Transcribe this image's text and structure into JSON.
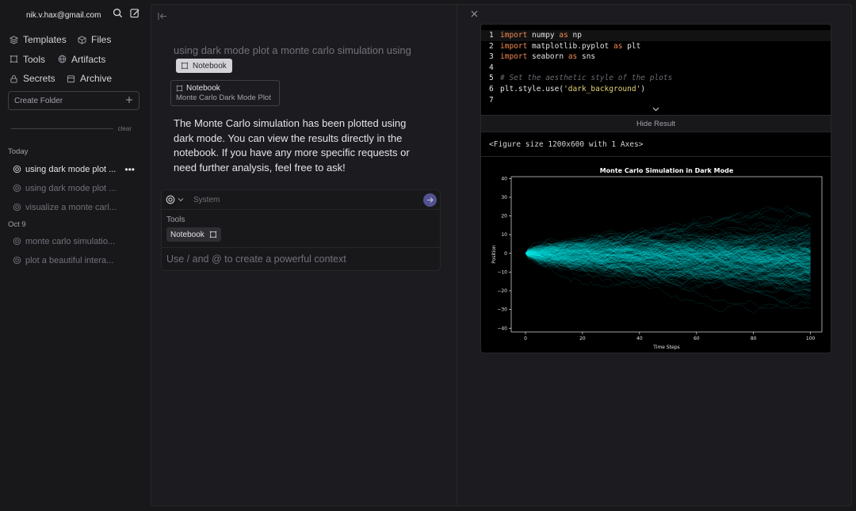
{
  "sidebar": {
    "user_email": "nik.v.hax@gmail.com",
    "nav": [
      {
        "label": "Templates",
        "icon": "layers-icon"
      },
      {
        "label": "Files",
        "icon": "box-icon"
      },
      {
        "label": "Tools",
        "icon": "tool-icon"
      },
      {
        "label": "Artifacts",
        "icon": "globe-icon"
      },
      {
        "label": "Secrets",
        "icon": "lock-icon"
      },
      {
        "label": "Archive",
        "icon": "archive-icon"
      }
    ],
    "create_folder_placeholder": "Create Folder",
    "clear_label": "clear",
    "sections": [
      {
        "label": "Today",
        "chats": [
          "using dark mode plot ...",
          "using dark mode plot ...",
          "visualize a monte carl..."
        ]
      },
      {
        "label": "Oct 9",
        "chats": [
          "monte carlo simulatio...",
          "plot a beautiful intera..."
        ]
      }
    ]
  },
  "chat": {
    "user_message": "using dark mode plot a monte carlo simulation using",
    "user_chip": "Notebook",
    "notebook_card_title": "Notebook",
    "notebook_card_subtitle": "Monte Carlo Dark Mode Plot",
    "assistant_message": "The Monte Carlo simulation has been plotted using dark mode. You can view the results directly in the notebook. If you have any more specific requests or need further analysis, feel free to ask!",
    "composer": {
      "system_placeholder": "System",
      "tools_label": "Tools",
      "tool_chip": "Notebook",
      "input_placeholder": "Use / and @ to create a powerful context"
    }
  },
  "notebook": {
    "code_lines": [
      {
        "n": "1",
        "parts": [
          {
            "t": "import",
            "c": "kw"
          },
          {
            "t": " numpy ",
            "c": ""
          },
          {
            "t": "as",
            "c": "kw"
          },
          {
            "t": " np",
            "c": ""
          }
        ]
      },
      {
        "n": "2",
        "parts": [
          {
            "t": "import",
            "c": "kw"
          },
          {
            "t": " matplotlib.pyplot ",
            "c": ""
          },
          {
            "t": "as",
            "c": "kw"
          },
          {
            "t": " plt",
            "c": ""
          }
        ]
      },
      {
        "n": "3",
        "parts": [
          {
            "t": "import",
            "c": "kw"
          },
          {
            "t": " seaborn ",
            "c": ""
          },
          {
            "t": "as",
            "c": "kw"
          },
          {
            "t": " sns",
            "c": ""
          }
        ]
      },
      {
        "n": "4",
        "parts": []
      },
      {
        "n": "5",
        "parts": [
          {
            "t": "# Set the aesthetic style of the plots",
            "c": "cm"
          }
        ]
      },
      {
        "n": "6",
        "parts": [
          {
            "t": "plt.style.use(",
            "c": ""
          },
          {
            "t": "'dark_background'",
            "c": "str"
          },
          {
            "t": ")",
            "c": ""
          }
        ]
      },
      {
        "n": "7",
        "parts": []
      }
    ],
    "hide_result_label": "Hide Result",
    "figure_text": "<Figure size 1200x600 with 1 Axes>"
  },
  "chart_data": {
    "type": "line",
    "title": "Monte Carlo Simulation in Dark Mode",
    "xlabel": "Time Steps",
    "ylabel": "Position",
    "xlim": [
      -5,
      104
    ],
    "ylim": [
      -42,
      41
    ],
    "xticks": [
      0,
      20,
      40,
      60,
      80,
      100
    ],
    "yticks": [
      -40,
      -30,
      -20,
      -10,
      0,
      10,
      20,
      30,
      40
    ],
    "series_count": 1000,
    "steps": 100,
    "color": "#00e5e5",
    "grid": false
  },
  "colors": {
    "accent": "#52528f",
    "trace": "#00e5e5"
  }
}
